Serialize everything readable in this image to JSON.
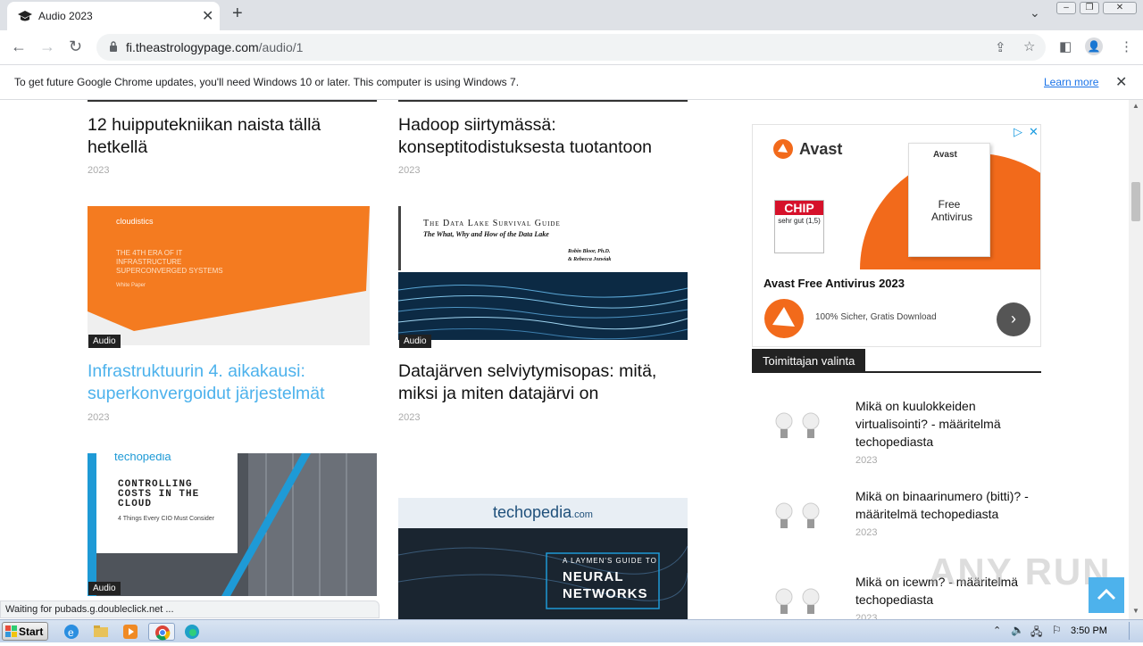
{
  "browser": {
    "tab_title": "Audio 2023",
    "url_host": "fi.theastrologypage.com",
    "url_path": "/audio/1",
    "infobar_text": "To get future Google Chrome updates, you'll need Windows 10 or later. This computer is using Windows 7.",
    "infobar_link": "Learn more",
    "status_text": "Waiting for pubads.g.doubleclick.net ..."
  },
  "posts": [
    {
      "title": "12 huipputekniikan naista tällä hetkellä",
      "year": "2023"
    },
    {
      "title": "Hadoop siirtymässä: konseptitodistuksesta tuotantoon",
      "year": "2023"
    },
    {
      "title": "Infrastruktuurin 4. aikakausi: superkonvergoidut järjestelmät",
      "year": "2023",
      "category": "Audio",
      "thumb": {
        "brand": "cloudistics",
        "line1": "THE 4TH ERA OF IT",
        "line2": "INFRASTRUCTURE",
        "line3": "SUPERCONVERGED SYSTEMS",
        "line4": "White Paper"
      }
    },
    {
      "title": "Datajärven selviytymisopas: mitä, miksi ja miten datajärvi on",
      "year": "2023",
      "category": "Audio",
      "thumb": {
        "head": "The Data Lake Survival Guide",
        "sub": "The What, Why and How of the Data Lake",
        "author1": "Robin Bloor, Ph.D.",
        "author2": "& Rebecca Jozwiak"
      }
    },
    {
      "category": "Audio",
      "thumb": {
        "brand": "techopedia",
        "line1": "CONTROLLING",
        "line2": "COSTS IN THE",
        "line3": "CLOUD",
        "line4": "4 Things Every CIO Must Consider"
      }
    },
    {
      "thumb": {
        "brand": "techopedia",
        "brand_suffix": ".com",
        "line1": "A LAYMEN'S GUIDE TO",
        "line2": "NEURAL",
        "line3": "NETWORKS"
      }
    }
  ],
  "ad": {
    "brand": "Avast",
    "box_text1": "Free",
    "box_text2": "Antivirus",
    "chip_text": "CHIP",
    "chip_rating": "sehr gut (1,5)",
    "title": "Avast Free Antivirus 2023",
    "subtitle": "100% Sicher, Gratis Download"
  },
  "sidebar": {
    "widget_title": "Toimittajan valinta",
    "items": [
      {
        "title": "Mikä on kuulokkeiden virtualisointi? - määritelmä techopediasta",
        "year": "2023"
      },
      {
        "title": "Mikä on binaarinumero (bitti)? - määritelmä techopediasta",
        "year": "2023"
      },
      {
        "title": "Mikä on icewm? - määritelmä techopediasta",
        "year": "2023"
      }
    ]
  },
  "taskbar": {
    "start": "Start",
    "clock": "3:50 PM"
  },
  "watermark": "ANY RUN",
  "colors": {
    "accent": "#4db2ec",
    "avast_orange": "#f26a1b",
    "dark": "#222222"
  }
}
